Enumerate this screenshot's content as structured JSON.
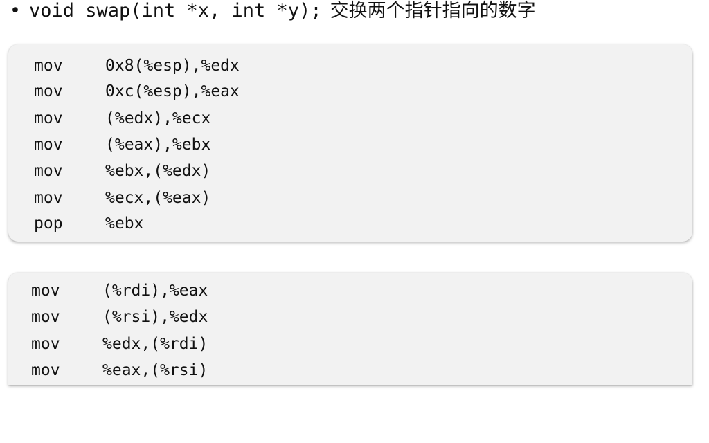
{
  "heading": {
    "bullet": "•",
    "signature": "void swap(int *x, int *y);",
    "description": "交换两个指针指向的数字"
  },
  "code_block_1": {
    "lines": [
      {
        "op": "mov",
        "args": "0x8(%esp),%edx"
      },
      {
        "op": "mov",
        "args": "0xc(%esp),%eax"
      },
      {
        "op": "mov",
        "args": "(%edx),%ecx"
      },
      {
        "op": "mov",
        "args": "(%eax),%ebx"
      },
      {
        "op": "mov",
        "args": "%ebx,(%edx)"
      },
      {
        "op": "mov",
        "args": "%ecx,(%eax)"
      },
      {
        "op": "pop",
        "args": "%ebx"
      }
    ]
  },
  "code_block_2": {
    "lines": [
      {
        "op": "mov",
        "args": "(%rdi),%eax"
      },
      {
        "op": "mov",
        "args": "(%rsi),%edx"
      },
      {
        "op": "mov",
        "args": "%edx,(%rdi)"
      },
      {
        "op": "mov",
        "args": "%eax,(%rsi)"
      }
    ]
  }
}
